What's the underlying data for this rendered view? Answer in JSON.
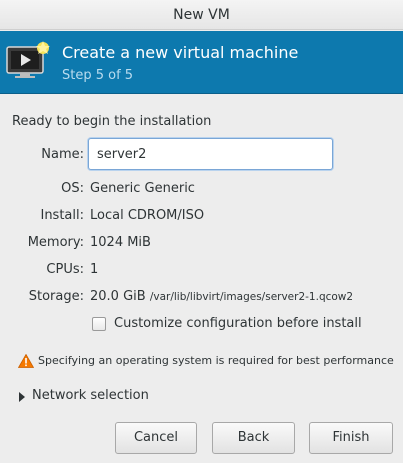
{
  "window": {
    "title": "New VM"
  },
  "header": {
    "title": "Create a new virtual machine",
    "step": "Step 5 of 5",
    "icon": "vm-monitor-icon"
  },
  "summary": {
    "heading": "Ready to begin the installation",
    "name_label": "Name:",
    "name_value": "server2",
    "os_label": "OS:",
    "os_value": "Generic Generic",
    "install_label": "Install:",
    "install_value": "Local CDROM/ISO",
    "memory_label": "Memory:",
    "memory_value": "1024 MiB",
    "cpus_label": "CPUs:",
    "cpus_value": "1",
    "storage_label": "Storage:",
    "storage_size": "20.0 GiB",
    "storage_path": "/var/lib/libvirt/images/server2-1.qcow2"
  },
  "customize": {
    "label": "Customize configuration before install",
    "checked": false
  },
  "warning": {
    "text": "Specifying an operating system is required for best performance",
    "icon": "warning-icon",
    "color": "#f57900"
  },
  "network": {
    "label": "Network selection",
    "icon": "expander-arrow-icon"
  },
  "buttons": {
    "cancel": "Cancel",
    "back": "Back",
    "finish": "Finish"
  },
  "colors": {
    "header_bg": "#0d79ae",
    "window_bg": "#ededed"
  }
}
